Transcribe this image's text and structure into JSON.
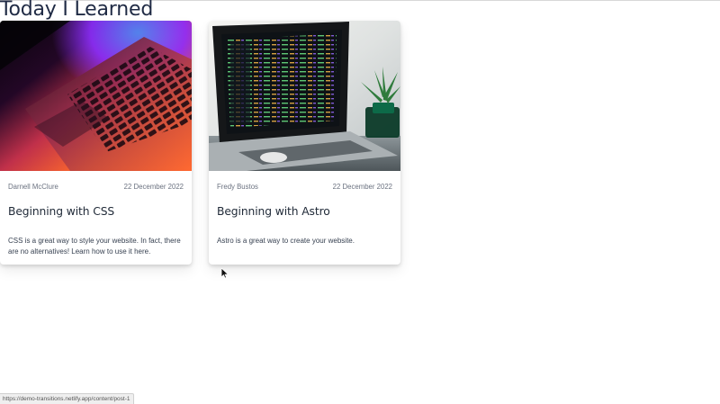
{
  "header": {
    "title": "Today I Learned"
  },
  "posts": [
    {
      "author": "Darnell McClure",
      "date": "22 December 2022",
      "title": "Beginning with CSS",
      "description": "CSS is a great way to style your website. In fact, there are no alternatives! Learn how to use it here.",
      "image": "laptop-keyboard-neon-lights-photo"
    },
    {
      "author": "Fredy Bustos",
      "date": "22 December 2022",
      "title": "Beginning with Astro",
      "description": "Astro is a great way to create your website.",
      "image": "laptop-code-editor-plant-photo"
    }
  ],
  "status_bar": {
    "url": "https://demo-transitions.netlify.app/content/post-1"
  },
  "colors": {
    "title_text": "#1f2a44",
    "meta_text": "#6b7280",
    "body_text": "#374151",
    "card_background": "#ffffff"
  },
  "icons": {
    "cursor": "arrow-cursor-icon"
  }
}
